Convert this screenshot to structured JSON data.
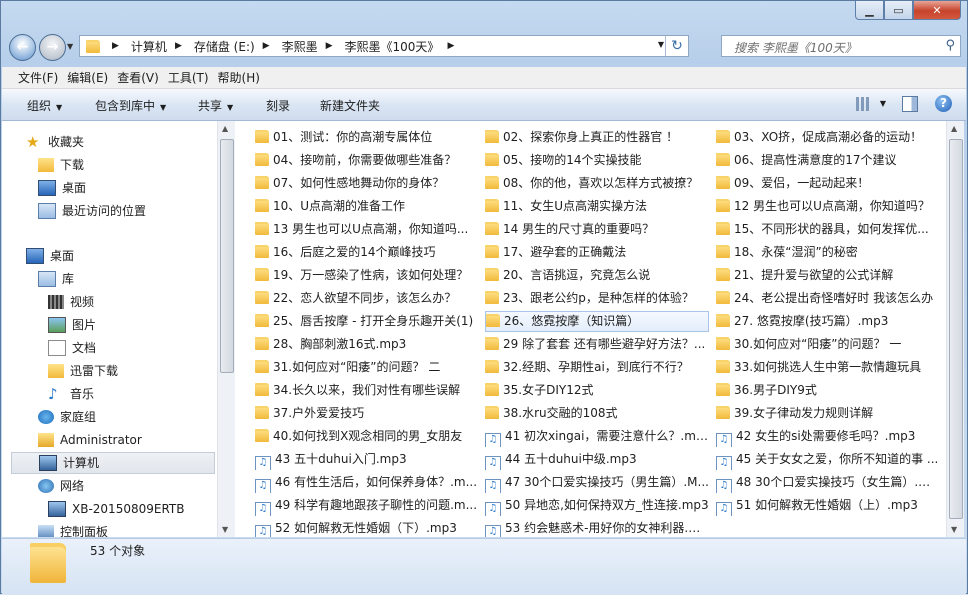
{
  "address": {
    "crumbs": [
      "计算机",
      "存储盘 (E:)",
      "李熙墨",
      "李熙墨《100天》"
    ]
  },
  "search": {
    "placeholder": "搜索 李熙墨《100天》"
  },
  "menu": [
    "文件(F)",
    "编辑(E)",
    "查看(V)",
    "工具(T)",
    "帮助(H)"
  ],
  "toolbar": {
    "organize": "组织",
    "include_library": "包含到库中",
    "share": "共享",
    "burn": "刻录",
    "new_folder": "新建文件夹"
  },
  "nav": [
    {
      "label": "收藏夹",
      "icon": "star-icon"
    },
    {
      "label": "下载",
      "icon": "downloads-folder-icon"
    },
    {
      "label": "桌面",
      "icon": "desktop-icon"
    },
    {
      "label": "最近访问的位置",
      "icon": "recent-places-icon"
    },
    {
      "label": "桌面",
      "icon": "desktop-icon"
    },
    {
      "label": "库",
      "icon": "library-icon"
    },
    {
      "label": "视频",
      "icon": "video-library-icon"
    },
    {
      "label": "图片",
      "icon": "pictures-library-icon"
    },
    {
      "label": "文档",
      "icon": "documents-library-icon"
    },
    {
      "label": "迅雷下载",
      "icon": "thunder-download-icon"
    },
    {
      "label": "音乐",
      "icon": "music-library-icon"
    },
    {
      "label": "家庭组",
      "icon": "homegroup-icon"
    },
    {
      "label": "Administrator",
      "icon": "user-folder-icon"
    },
    {
      "label": "计算机",
      "icon": "computer-icon"
    },
    {
      "label": "网络",
      "icon": "network-icon"
    },
    {
      "label": "XB-20150809ERTB",
      "icon": "network-computer-icon"
    },
    {
      "label": "控制面板",
      "icon": "control-panel-icon"
    }
  ],
  "files": [
    {
      "name": "01、测试：你的高潮专属体位",
      "type": "folder"
    },
    {
      "name": "02、探索你身上真正的性器官 ！",
      "type": "folder"
    },
    {
      "name": "03、XO挤，促成高潮必备的运动！",
      "type": "folder"
    },
    {
      "name": "04、接吻前，你需要做哪些准备？",
      "type": "folder"
    },
    {
      "name": "05、接吻的14个实操技能",
      "type": "folder"
    },
    {
      "name": "06、提高性满意度的17个建议",
      "type": "folder"
    },
    {
      "name": "07、如何性感地舞动你的身体？",
      "type": "folder"
    },
    {
      "name": "08、你的他，喜欢以怎样方式被撩？",
      "type": "folder"
    },
    {
      "name": "09、爱侣，一起动起来！",
      "type": "folder"
    },
    {
      "name": "10、U点高潮的准备工作",
      "type": "folder"
    },
    {
      "name": "11、女生U点高潮实操方法",
      "type": "folder"
    },
    {
      "name": "12 男生也可以U点高潮，你知道吗？",
      "type": "folder"
    },
    {
      "name": "13 男生也可以U点高潮，你知道吗...",
      "type": "folder"
    },
    {
      "name": "14 男生的尺寸真的重要吗？",
      "type": "folder"
    },
    {
      "name": "15、不同形状的器具，如何发挥优...",
      "type": "folder"
    },
    {
      "name": "16、后庭之爱的14个巅峰技巧",
      "type": "folder"
    },
    {
      "name": "17、避孕套的正确戴法",
      "type": "folder"
    },
    {
      "name": "18、永葆“湿润”的秘密",
      "type": "folder"
    },
    {
      "name": "19、万一感染了性病，该如何处理？",
      "type": "folder"
    },
    {
      "name": "20、言语挑逗，究竟怎么说",
      "type": "folder"
    },
    {
      "name": "21、提升爱与欲望的公式详解",
      "type": "folder"
    },
    {
      "name": "22、恋人欲望不同步，该怎么办？",
      "type": "folder"
    },
    {
      "name": "23、跟老公约p，是种怎样的体验？",
      "type": "folder"
    },
    {
      "name": "24、老公提出奇怪嗜好时 我该怎么办",
      "type": "folder"
    },
    {
      "name": "25、唇舌按摩 - 打开全身乐趣开关(1)",
      "type": "folder"
    },
    {
      "name": "26、悠霓按摩（知识篇）",
      "type": "folder"
    },
    {
      "name": "27. 悠霓按摩(技巧篇）.mp3",
      "type": "folder"
    },
    {
      "name": "28、胸部刺激16式.mp3",
      "type": "folder"
    },
    {
      "name": "29 除了套套 还有哪些避孕好方法？...",
      "type": "folder"
    },
    {
      "name": "30.如何应对“阳痿”的问题？ 一",
      "type": "folder"
    },
    {
      "name": "31.如何应对“阳痿”的问题？ 二",
      "type": "folder"
    },
    {
      "name": "32.经期、孕期性ai，到底行不行？",
      "type": "folder"
    },
    {
      "name": "33.如何挑选人生中第一款情趣玩具",
      "type": "folder"
    },
    {
      "name": "34.长久以来，我们对性有哪些误解",
      "type": "folder"
    },
    {
      "name": "35.女子DIY12式",
      "type": "folder"
    },
    {
      "name": "36.男子DIY9式",
      "type": "folder"
    },
    {
      "name": "37.户外爱爱技巧",
      "type": "folder"
    },
    {
      "name": "38.水ru交融的108式",
      "type": "folder"
    },
    {
      "name": "39.女子律动发力规则详解",
      "type": "folder"
    },
    {
      "name": "40.如何找到X观念相同的男_女朋友",
      "type": "folder"
    },
    {
      "name": "41 初次xingai，需要注意什么？.mp3",
      "type": "mp3"
    },
    {
      "name": "42 女生的si处需要修毛吗？.mp3",
      "type": "mp3"
    },
    {
      "name": "43 五十duhui入门.mp3",
      "type": "mp3"
    },
    {
      "name": "44 五十duhui中级.mp3",
      "type": "mp3"
    },
    {
      "name": "45 关于女女之爱，你所不知道的事 ...",
      "type": "mp3"
    },
    {
      "name": "46 有性生活后，如何保养身体？.m...",
      "type": "mp3"
    },
    {
      "name": "47 30个口爱实操技巧（男生篇）.M...",
      "type": "mp3"
    },
    {
      "name": "48 30个口爱实操技巧（女生篇）.m...",
      "type": "mp3"
    },
    {
      "name": "49 科学有趣地跟孩子聊性的问题.m...",
      "type": "mp3"
    },
    {
      "name": "50 异地恋,如何保持双方_性连接.mp3",
      "type": "mp3"
    },
    {
      "name": "51 如何解救无性婚姻（上）.mp3",
      "type": "mp3"
    },
    {
      "name": "52 如何解救无性婚姻（下）.mp3",
      "type": "mp3"
    },
    {
      "name": "53 约会魅惑术-用好你的女神利器.m...",
      "type": "mp3"
    }
  ],
  "selected_file_index": 25,
  "selected_nav_index": 13,
  "status": {
    "count_text": "53 个对象"
  }
}
